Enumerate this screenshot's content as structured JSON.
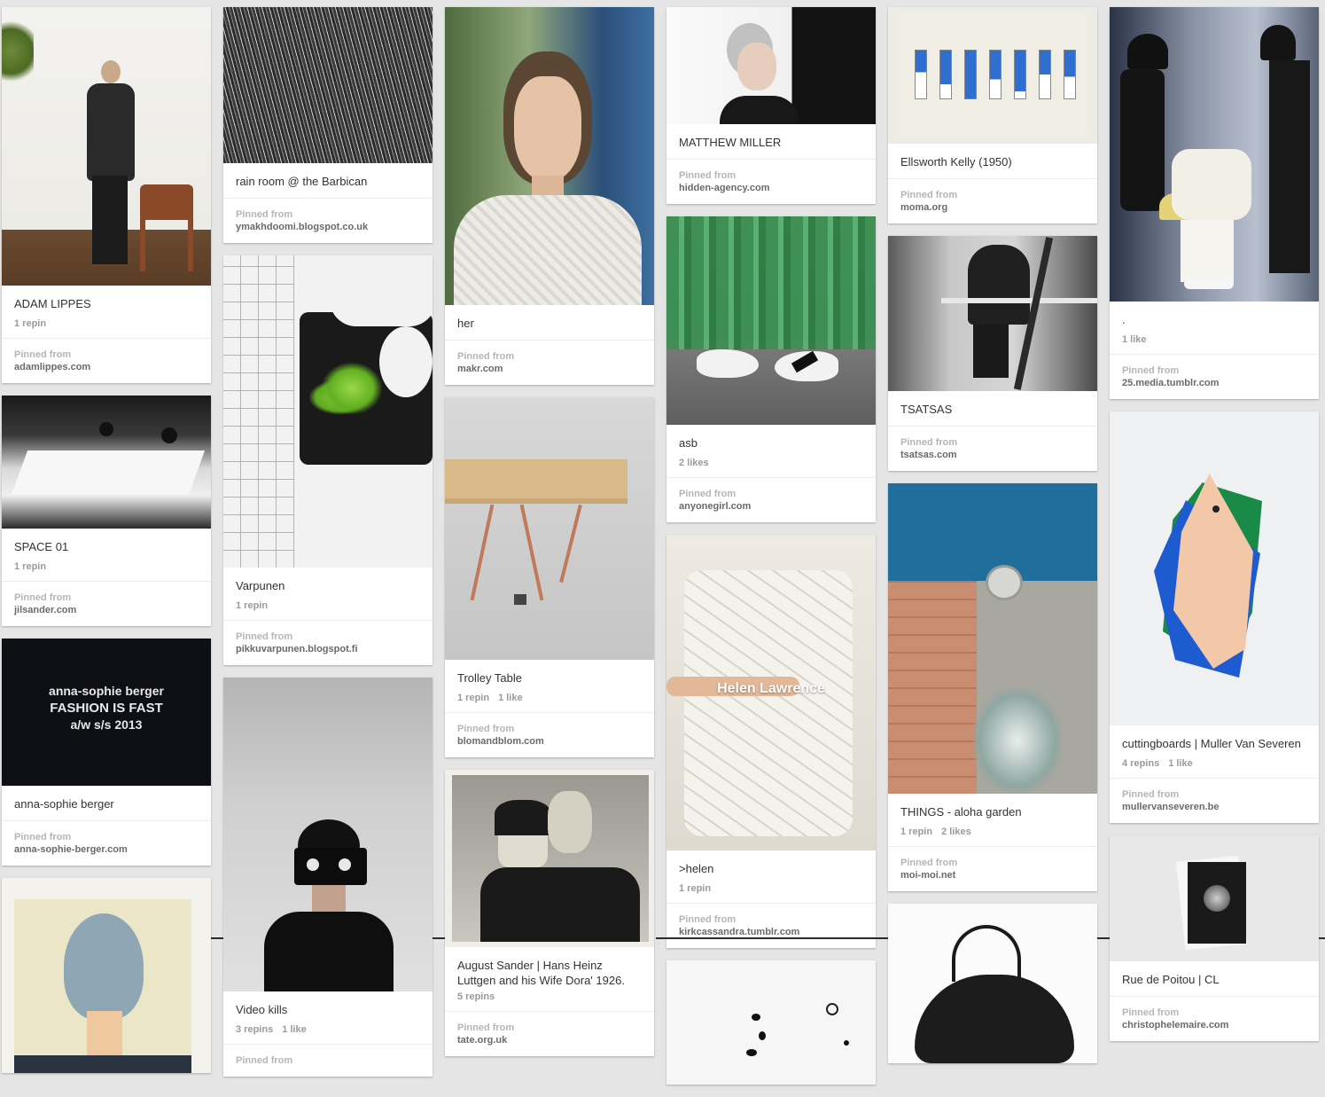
{
  "pins": {
    "adam_lippes": {
      "title": "ADAM LIPPES",
      "repins": "1 repin",
      "pinned_label": "Pinned from",
      "domain": "adamlippes.com"
    },
    "space01": {
      "title": "SPACE 01",
      "repins": "1 repin",
      "pinned_label": "Pinned from",
      "domain": "jilsander.com"
    },
    "asb_berger": {
      "title": "anna-sophie berger",
      "pinned_label": "Pinned from",
      "domain": "anna-sophie-berger.com",
      "image_text": [
        "anna-sophie berger",
        "FASHION IS FAST",
        "a/w s/s 2013"
      ]
    },
    "rain_room": {
      "title": "rain room @ the Barbican",
      "pinned_label": "Pinned from",
      "domain": "ymakhdoomi.blogspot.co.uk"
    },
    "varpunen": {
      "title": "Varpunen",
      "repins": "1 repin",
      "pinned_label": "Pinned from",
      "domain": "pikkuvarpunen.blogspot.fi"
    },
    "video_kills": {
      "title": "Video kills",
      "repins": "3 repins",
      "likes": "1 like",
      "pinned_label": "Pinned from"
    },
    "her": {
      "title": "her",
      "pinned_label": "Pinned from",
      "domain": "makr.com"
    },
    "trolley": {
      "title": "Trolley Table",
      "repins": "1 repin",
      "likes": "1 like",
      "pinned_label": "Pinned from",
      "domain": "blomandblom.com"
    },
    "sander": {
      "title": "August Sander | Hans Heinz Luttgen and his Wife Dora' 1926.",
      "repins": "5 repins",
      "pinned_label": "Pinned from",
      "domain": "tate.org.uk"
    },
    "matthew": {
      "title": "MATTHEW MILLER",
      "pinned_label": "Pinned from",
      "domain": "hidden-agency.com"
    },
    "asb": {
      "title": "asb",
      "likes": "2 likes",
      "pinned_label": "Pinned from",
      "domain": "anyonegirl.com"
    },
    "helen": {
      "title": ">helen",
      "repins": "1 repin",
      "pinned_label": "Pinned from",
      "domain": "kirkcassandra.tumblr.com",
      "image_text": "Helen Lawrence"
    },
    "kelly": {
      "title": "Ellsworth Kelly (1950)",
      "pinned_label": "Pinned from",
      "domain": "moma.org"
    },
    "tsatsas": {
      "title": "TSATSAS",
      "pinned_label": "Pinned from",
      "domain": "tsatsas.com"
    },
    "things": {
      "title": "THINGS - aloha garden",
      "repins": "1 repin",
      "likes": "2 likes",
      "pinned_label": "Pinned from",
      "domain": "moi-moi.net"
    },
    "dot": {
      "title": ".",
      "likes": "1 like",
      "pinned_label": "Pinned from",
      "domain": "25.media.tumblr.com"
    },
    "cutting": {
      "title": "cuttingboards | Muller Van Severen",
      "repins": "4 repins",
      "likes": "1 like",
      "pinned_label": "Pinned from",
      "domain": "mullervanseveren.be"
    },
    "poitou": {
      "title": "Rue de Poitou | CL",
      "pinned_label": "Pinned from",
      "domain": "christophelemaire.com"
    }
  }
}
